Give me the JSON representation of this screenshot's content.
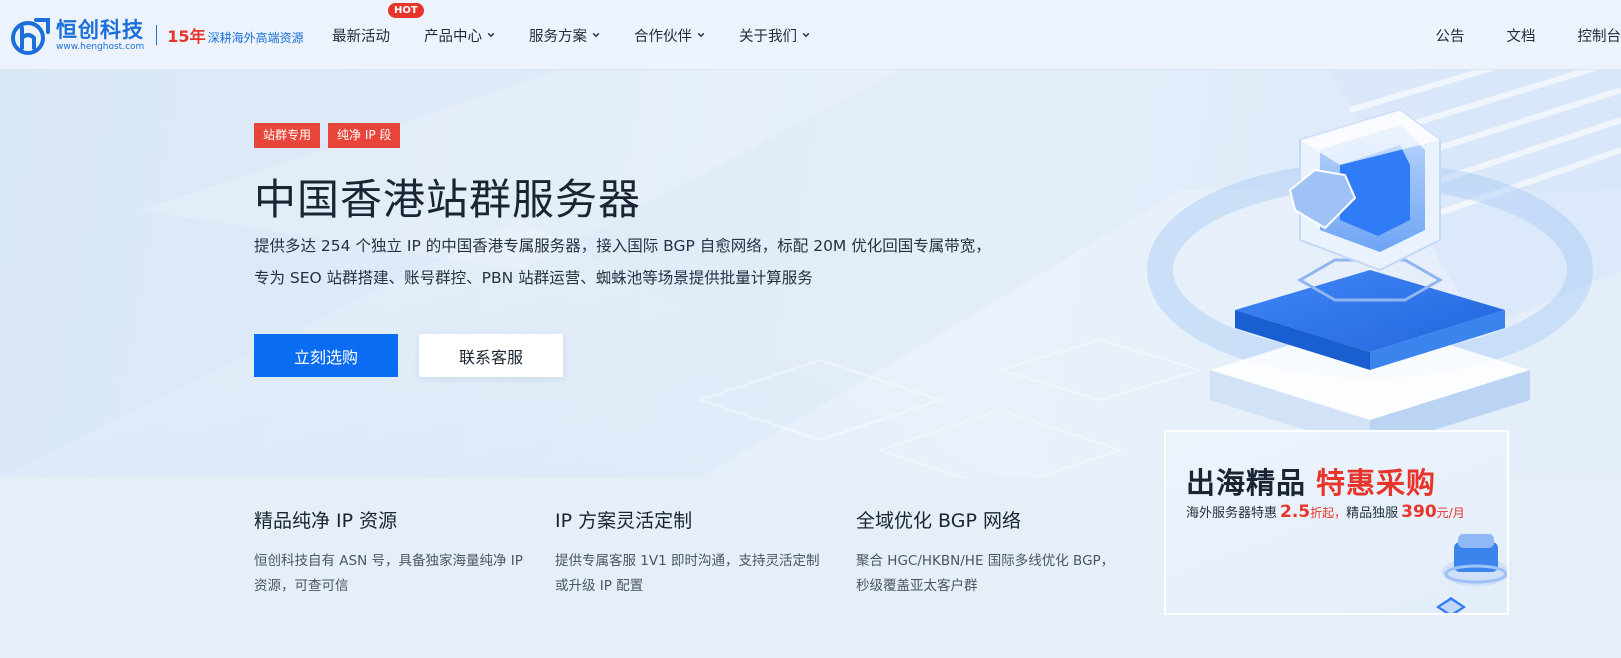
{
  "header": {
    "logo": {
      "name": "恒创科技",
      "url": "www.henghost.com",
      "years": "15年",
      "slogan": "深耕海外高端资源"
    },
    "nav": [
      {
        "label": "最新活动",
        "badge": "HOT",
        "has_dropdown": false
      },
      {
        "label": "产品中心",
        "has_dropdown": true
      },
      {
        "label": "服务方案",
        "has_dropdown": true
      },
      {
        "label": "合作伙伴",
        "has_dropdown": true
      },
      {
        "label": "关于我们",
        "has_dropdown": true
      }
    ],
    "right_nav": [
      "公告",
      "文档",
      "控制台"
    ]
  },
  "hero": {
    "tags": [
      "站群专用",
      "纯净 IP 段"
    ],
    "title": "中国香港站群服务器",
    "description": "提供多达 254 个独立 IP 的中国香港专属服务器，接入国际 BGP 自愈网络，标配 20M 优化回国专属带宽，专为 SEO 站群搭建、账号群控、PBN 站群运营、蜘蛛池等场景提供批量计算服务",
    "primary_button": "立刻选购",
    "secondary_button": "联系客服"
  },
  "features": [
    {
      "title": "精品纯净 IP 资源",
      "desc": "恒创科技自有 ASN 号，具备独家海量纯净 IP 资源，可查可信"
    },
    {
      "title": "IP 方案灵活定制",
      "desc": "提供专属客服 1V1 即时沟通，支持灵活定制或升级 IP 配置"
    },
    {
      "title": "全域优化 BGP 网络",
      "desc": "聚合 HGC/HKBN/HE 国际多线优化 BGP，秒级覆盖亚太客户群"
    }
  ],
  "promo": {
    "title_part1": "出海精品",
    "title_part2": "特惠采购",
    "sub_text1": "海外服务器特惠",
    "discount": "2.5",
    "discount_unit": "折起，",
    "sub_text2": "精品独服",
    "price": "390",
    "price_unit": "元/月"
  },
  "colors": {
    "brand_blue": "#1a6fd8",
    "primary_button": "#0a6cf2",
    "accent_red": "#e8352b",
    "tag_red": "#e8453a"
  }
}
